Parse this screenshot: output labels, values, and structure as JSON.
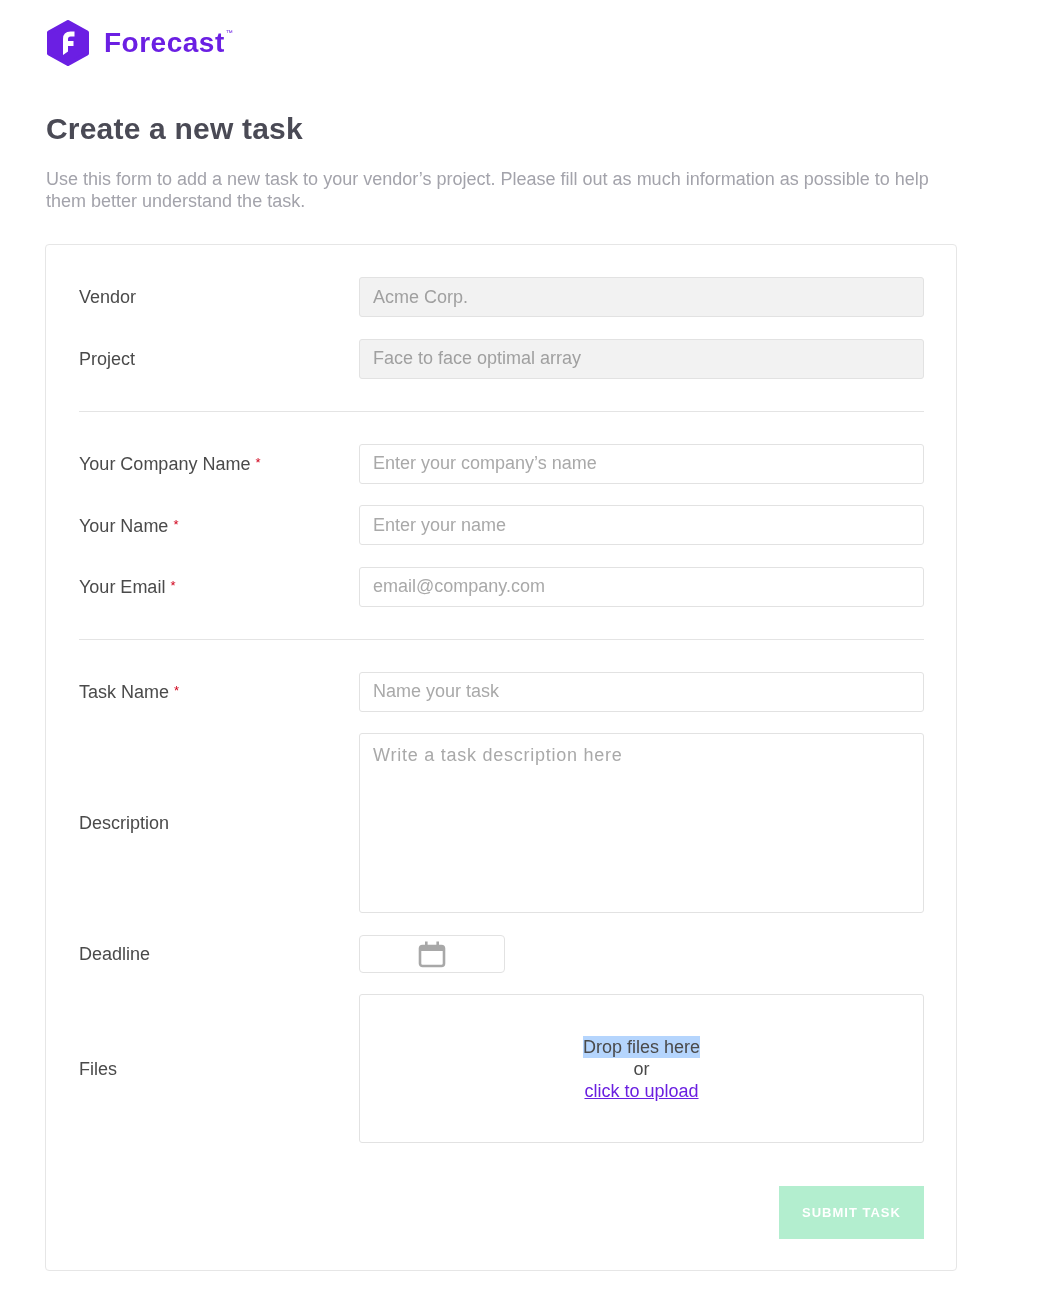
{
  "brand": {
    "name": "Forecast",
    "mark": "™"
  },
  "title": "Create a new task",
  "intro": "Use this form to add a new task to your vendor’s project. Please fill out as much information as possible to help them better understand the task.",
  "form": {
    "required_mark": "*",
    "sections": [
      [
        {
          "kind": "readonly",
          "label": "Vendor",
          "value": "Acme Corp.",
          "required": false
        },
        {
          "kind": "readonly",
          "label": "Project",
          "value": "Face to face optimal array",
          "required": false
        }
      ],
      [
        {
          "kind": "text",
          "label": "Your Company Name",
          "placeholder": "Enter your company’s name",
          "required": true
        },
        {
          "kind": "text",
          "label": "Your Name",
          "placeholder": "Enter your name",
          "required": true
        },
        {
          "kind": "text",
          "label": "Your Email",
          "placeholder": "email@company.com",
          "required": true
        }
      ],
      [
        {
          "kind": "text",
          "label": "Task Name",
          "placeholder": "Name your task",
          "required": true
        },
        {
          "kind": "textarea",
          "label": "Description",
          "placeholder": "Write a task description here",
          "required": false
        },
        {
          "kind": "date",
          "label": "Deadline",
          "required": false
        },
        {
          "kind": "files",
          "label": "Files",
          "required": false,
          "drop_text": "Drop files here",
          "drop_text_highlighted": true,
          "separator": "or",
          "link": "click to upload"
        }
      ]
    ],
    "submit": {
      "label": "SUBMIT TASK",
      "disabled": true
    }
  }
}
